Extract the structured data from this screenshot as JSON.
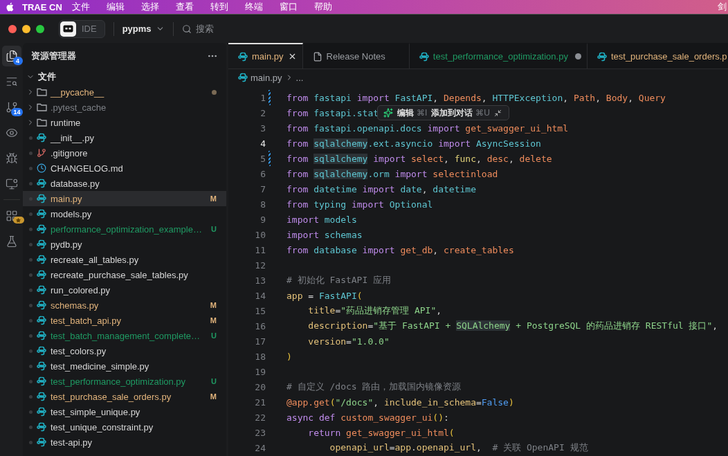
{
  "menubar": {
    "app": "TRAE CN",
    "items": [
      "文件",
      "编辑",
      "选择",
      "查看",
      "转到",
      "终端",
      "窗口",
      "帮助"
    ],
    "user": "剑"
  },
  "titlebar": {
    "mode": "IDE",
    "project": "pypms",
    "search_placeholder": "搜索"
  },
  "activity": [
    {
      "kind": "files",
      "selected": true,
      "badge": "4",
      "starred": false
    },
    {
      "kind": "search",
      "selected": false,
      "starred": false
    },
    {
      "kind": "branch",
      "selected": false,
      "badge": "14",
      "starred": false
    },
    {
      "kind": "eye",
      "selected": false,
      "starred": false
    },
    {
      "kind": "bug",
      "selected": false,
      "starred": false
    },
    {
      "kind": "monitor",
      "selected": false,
      "starred": false
    },
    {
      "kind": "grid",
      "selected": false,
      "starred": true
    },
    {
      "kind": "flask",
      "selected": false,
      "starred": false
    }
  ],
  "explorer": {
    "title": "资源管理器",
    "tree": [
      {
        "label": "文件",
        "kind": "folder",
        "expanded": true,
        "selected": false,
        "children": [
          {
            "label": "__pycache__",
            "kind": "folder",
            "expanded": false,
            "selected": false,
            "modified": false,
            "untracked": false,
            "ignored": false,
            "dirty": true
          },
          {
            "label": ".pytest_cache",
            "kind": "folder",
            "expanded": false,
            "selected": false,
            "modified": false,
            "untracked": false,
            "ignored": true,
            "dirty": false
          },
          {
            "label": "runtime",
            "kind": "folder",
            "expanded": false,
            "selected": false,
            "modified": false,
            "untracked": false,
            "ignored": false,
            "dirty": false
          },
          {
            "label": "__init__.py",
            "kind": "python",
            "selected": false,
            "modified": false,
            "untracked": false,
            "ignored": false,
            "dirty": false
          },
          {
            "label": ".gitignore",
            "kind": "git",
            "selected": false,
            "modified": false,
            "untracked": false,
            "ignored": false,
            "dirty": false
          },
          {
            "label": "CHANGELOG.md",
            "kind": "clock",
            "selected": false,
            "modified": false,
            "untracked": false,
            "ignored": false,
            "dirty": false
          },
          {
            "label": "database.py",
            "kind": "python",
            "selected": false,
            "modified": false,
            "untracked": false,
            "ignored": false,
            "dirty": false
          },
          {
            "label": "main.py",
            "kind": "python",
            "selected": true,
            "modified": true,
            "untracked": false,
            "ignored": false,
            "dirty": false,
            "badge": "M"
          },
          {
            "label": "models.py",
            "kind": "python",
            "selected": false,
            "modified": false,
            "untracked": false,
            "ignored": false,
            "dirty": false
          },
          {
            "label": "performance_optimization_example…",
            "kind": "python",
            "selected": false,
            "modified": false,
            "untracked": true,
            "ignored": false,
            "dirty": false,
            "badge": "U"
          },
          {
            "label": "pydb.py",
            "kind": "python",
            "selected": false,
            "modified": false,
            "untracked": false,
            "ignored": false,
            "dirty": false
          },
          {
            "label": "recreate_all_tables.py",
            "kind": "python",
            "selected": false,
            "modified": false,
            "untracked": false,
            "ignored": false,
            "dirty": false
          },
          {
            "label": "recreate_purchase_sale_tables.py",
            "kind": "python",
            "selected": false,
            "modified": false,
            "untracked": false,
            "ignored": false,
            "dirty": false
          },
          {
            "label": "run_colored.py",
            "kind": "python",
            "selected": false,
            "modified": false,
            "untracked": false,
            "ignored": false,
            "dirty": false
          },
          {
            "label": "schemas.py",
            "kind": "python",
            "selected": false,
            "modified": true,
            "untracked": false,
            "ignored": false,
            "dirty": false,
            "badge": "M"
          },
          {
            "label": "test_batch_api.py",
            "kind": "python",
            "selected": false,
            "modified": true,
            "untracked": false,
            "ignored": false,
            "dirty": false,
            "badge": "M"
          },
          {
            "label": "test_batch_management_complete…",
            "kind": "python",
            "selected": false,
            "modified": false,
            "untracked": true,
            "ignored": false,
            "dirty": false,
            "badge": "U"
          },
          {
            "label": "test_colors.py",
            "kind": "python",
            "selected": false,
            "modified": false,
            "untracked": false,
            "ignored": false,
            "dirty": false
          },
          {
            "label": "test_medicine_simple.py",
            "kind": "python",
            "selected": false,
            "modified": false,
            "untracked": false,
            "ignored": false,
            "dirty": false
          },
          {
            "label": "test_performance_optimization.py",
            "kind": "python",
            "selected": false,
            "modified": false,
            "untracked": true,
            "ignored": false,
            "dirty": false,
            "badge": "U"
          },
          {
            "label": "test_purchase_sale_orders.py",
            "kind": "python",
            "selected": false,
            "modified": true,
            "untracked": false,
            "ignored": false,
            "dirty": false,
            "badge": "M"
          },
          {
            "label": "test_simple_unique.py",
            "kind": "python",
            "selected": false,
            "modified": false,
            "untracked": false,
            "ignored": false,
            "dirty": false
          },
          {
            "label": "test_unique_constraint.py",
            "kind": "python",
            "selected": false,
            "modified": false,
            "untracked": false,
            "ignored": false,
            "dirty": false
          },
          {
            "label": "test-api.py",
            "kind": "python",
            "selected": false,
            "modified": false,
            "untracked": false,
            "ignored": false,
            "dirty": false
          }
        ]
      }
    ]
  },
  "tabs": [
    {
      "label": "main.py",
      "kind": "python",
      "selected": true,
      "dirty": false,
      "modified": true,
      "untracked": false
    },
    {
      "label": "Release Notes",
      "kind": "doc",
      "selected": false,
      "dirty": false,
      "modified": false,
      "untracked": false
    },
    {
      "label": "test_performance_optimization.py",
      "kind": "python",
      "selected": false,
      "dirty": true,
      "modified": false,
      "untracked": true
    },
    {
      "label": "test_purchase_sale_orders.p",
      "kind": "python",
      "selected": false,
      "dirty": false,
      "modified": true,
      "untracked": false
    }
  ],
  "breadcrumb": [
    "main.py",
    "..."
  ],
  "popup": {
    "edit_label": "编辑",
    "edit_shortcut": "⌘I",
    "add_label": "添加到对话",
    "add_shortcut": "⌘U"
  },
  "code": [
    {
      "n": "1",
      "current": false,
      "changed": true,
      "tokens": [
        {
          "kind": "kw",
          "text": "from "
        },
        {
          "kind": "mod",
          "text": "fastapi "
        },
        {
          "kind": "kw",
          "text": "import "
        },
        {
          "kind": "cls",
          "text": "FastAPI"
        },
        {
          "kind": "p",
          "text": ", "
        },
        {
          "kind": "name",
          "text": "Depends"
        },
        {
          "kind": "p",
          "text": ", "
        },
        {
          "kind": "cls",
          "text": "HTTPException"
        },
        {
          "kind": "p",
          "text": ", "
        },
        {
          "kind": "name",
          "text": "Path"
        },
        {
          "kind": "p",
          "text": ", "
        },
        {
          "kind": "name",
          "text": "Body"
        },
        {
          "kind": "p",
          "text": ", "
        },
        {
          "kind": "name",
          "text": "Query"
        }
      ]
    },
    {
      "n": "2",
      "current": false,
      "changed": false,
      "tokens": [
        {
          "kind": "kw",
          "text": "from "
        },
        {
          "kind": "mod",
          "text": "fastapi.stat"
        }
      ]
    },
    {
      "n": "3",
      "current": false,
      "changed": false,
      "tokens": [
        {
          "kind": "kw",
          "text": "from "
        },
        {
          "kind": "mod",
          "text": "fastapi.openapi.docs "
        },
        {
          "kind": "kw",
          "text": "import "
        },
        {
          "kind": "name",
          "text": "get_swagger_ui_html"
        }
      ]
    },
    {
      "n": "4",
      "current": true,
      "changed": false,
      "tokens": [
        {
          "kind": "kw",
          "text": "from "
        },
        {
          "kind": "match",
          "text": "sqlalchemy"
        },
        {
          "kind": "mod",
          "text": ".ext.asyncio "
        },
        {
          "kind": "kw",
          "text": "import "
        },
        {
          "kind": "cls",
          "text": "AsyncSession"
        }
      ]
    },
    {
      "n": "5",
      "current": false,
      "changed": true,
      "tokens": [
        {
          "kind": "kw",
          "text": "from "
        },
        {
          "kind": "match",
          "text": "sqlalchemy"
        },
        {
          "kind": "kw",
          "text": " import "
        },
        {
          "kind": "name",
          "text": "select"
        },
        {
          "kind": "p",
          "text": ", "
        },
        {
          "kind": "fn",
          "text": "func"
        },
        {
          "kind": "p",
          "text": ", "
        },
        {
          "kind": "name",
          "text": "desc"
        },
        {
          "kind": "p",
          "text": ", "
        },
        {
          "kind": "name",
          "text": "delete"
        }
      ]
    },
    {
      "n": "6",
      "current": false,
      "changed": false,
      "tokens": [
        {
          "kind": "kw",
          "text": "from "
        },
        {
          "kind": "match",
          "text": "sqlalchemy"
        },
        {
          "kind": "mod",
          "text": ".orm "
        },
        {
          "kind": "kw",
          "text": "import "
        },
        {
          "kind": "name",
          "text": "selectinload"
        }
      ]
    },
    {
      "n": "7",
      "current": false,
      "changed": false,
      "tokens": [
        {
          "kind": "kw",
          "text": "from "
        },
        {
          "kind": "mod",
          "text": "datetime "
        },
        {
          "kind": "kw",
          "text": "import "
        },
        {
          "kind": "cls",
          "text": "date"
        },
        {
          "kind": "p",
          "text": ", "
        },
        {
          "kind": "cls",
          "text": "datetime"
        }
      ]
    },
    {
      "n": "8",
      "current": false,
      "changed": false,
      "tokens": [
        {
          "kind": "kw",
          "text": "from "
        },
        {
          "kind": "mod",
          "text": "typing "
        },
        {
          "kind": "kw",
          "text": "import "
        },
        {
          "kind": "cls",
          "text": "Optional"
        }
      ]
    },
    {
      "n": "9",
      "current": false,
      "changed": false,
      "tokens": [
        {
          "kind": "kw",
          "text": "import "
        },
        {
          "kind": "mod",
          "text": "models"
        }
      ]
    },
    {
      "n": "10",
      "current": false,
      "changed": false,
      "tokens": [
        {
          "kind": "kw",
          "text": "import "
        },
        {
          "kind": "mod",
          "text": "schemas"
        }
      ]
    },
    {
      "n": "11",
      "current": false,
      "changed": false,
      "tokens": [
        {
          "kind": "kw",
          "text": "from "
        },
        {
          "kind": "mod",
          "text": "database "
        },
        {
          "kind": "kw",
          "text": "import "
        },
        {
          "kind": "name",
          "text": "get_db"
        },
        {
          "kind": "p",
          "text": ", "
        },
        {
          "kind": "name",
          "text": "create_tables"
        }
      ]
    },
    {
      "n": "12",
      "current": false,
      "changed": false
    },
    {
      "n": "13",
      "current": false,
      "changed": false,
      "tokens": [
        {
          "kind": "cm",
          "text": "# 初始化 FastAPI 应用"
        }
      ]
    },
    {
      "n": "14",
      "current": false,
      "changed": false,
      "tokens": [
        {
          "kind": "param",
          "text": "app"
        },
        {
          "kind": "p",
          "text": " = "
        },
        {
          "kind": "cls",
          "text": "FastAPI"
        },
        {
          "kind": "paren",
          "text": "("
        }
      ]
    },
    {
      "n": "15",
      "current": false,
      "changed": false,
      "tokens": [
        {
          "kind": "param",
          "text": "    title"
        },
        {
          "kind": "p",
          "text": "="
        },
        {
          "kind": "str",
          "text": "\"药品进销存管理 API\""
        },
        {
          "kind": "p",
          "text": ","
        }
      ]
    },
    {
      "n": "16",
      "current": false,
      "changed": false,
      "tokens": [
        {
          "kind": "param",
          "text": "    description"
        },
        {
          "kind": "p",
          "text": "="
        },
        {
          "kind": "str",
          "text": "\"基于 FastAPI + "
        },
        {
          "kind": "strmatch",
          "text": "SQLAlchemy"
        },
        {
          "kind": "str",
          "text": " + PostgreSQL 的药品进销存 RESTful 接口\""
        },
        {
          "kind": "p",
          "text": ","
        }
      ]
    },
    {
      "n": "17",
      "current": false,
      "changed": false,
      "tokens": [
        {
          "kind": "param",
          "text": "    version"
        },
        {
          "kind": "p",
          "text": "="
        },
        {
          "kind": "str",
          "text": "\"1.0.0\""
        }
      ]
    },
    {
      "n": "18",
      "current": false,
      "changed": false,
      "tokens": [
        {
          "kind": "paren",
          "text": ")"
        }
      ]
    },
    {
      "n": "19",
      "current": false,
      "changed": false
    },
    {
      "n": "20",
      "current": false,
      "changed": false,
      "tokens": [
        {
          "kind": "cm",
          "text": "# 自定义 /docs 路由，加载国内镜像资源"
        }
      ]
    },
    {
      "n": "21",
      "current": false,
      "changed": false,
      "tokens": [
        {
          "kind": "dec",
          "text": "@app.get"
        },
        {
          "kind": "paren",
          "text": "("
        },
        {
          "kind": "str",
          "text": "\"/docs\""
        },
        {
          "kind": "p",
          "text": ", "
        },
        {
          "kind": "param",
          "text": "include_in_schema"
        },
        {
          "kind": "p",
          "text": "="
        },
        {
          "kind": "const",
          "text": "False"
        },
        {
          "kind": "paren",
          "text": ")"
        }
      ]
    },
    {
      "n": "22",
      "current": false,
      "changed": false,
      "tokens": [
        {
          "kind": "kw",
          "text": "async def "
        },
        {
          "kind": "name",
          "text": "custom_swagger_ui"
        },
        {
          "kind": "paren",
          "text": "()"
        },
        {
          "kind": "p",
          "text": ":"
        }
      ]
    },
    {
      "n": "23",
      "current": false,
      "changed": false,
      "tokens": [
        {
          "kind": "kw",
          "text": "    return "
        },
        {
          "kind": "name",
          "text": "get_swagger_ui_html"
        },
        {
          "kind": "paren",
          "text": "("
        }
      ]
    },
    {
      "n": "24",
      "current": false,
      "changed": false,
      "tokens": [
        {
          "kind": "param",
          "text": "        openapi_url"
        },
        {
          "kind": "p",
          "text": "="
        },
        {
          "kind": "param",
          "text": "app"
        },
        {
          "kind": "p",
          "text": "."
        },
        {
          "kind": "param",
          "text": "openapi_url"
        },
        {
          "kind": "p",
          "text": ",  "
        },
        {
          "kind": "cm",
          "text": "# 关联 OpenAPI 规范"
        }
      ]
    }
  ]
}
